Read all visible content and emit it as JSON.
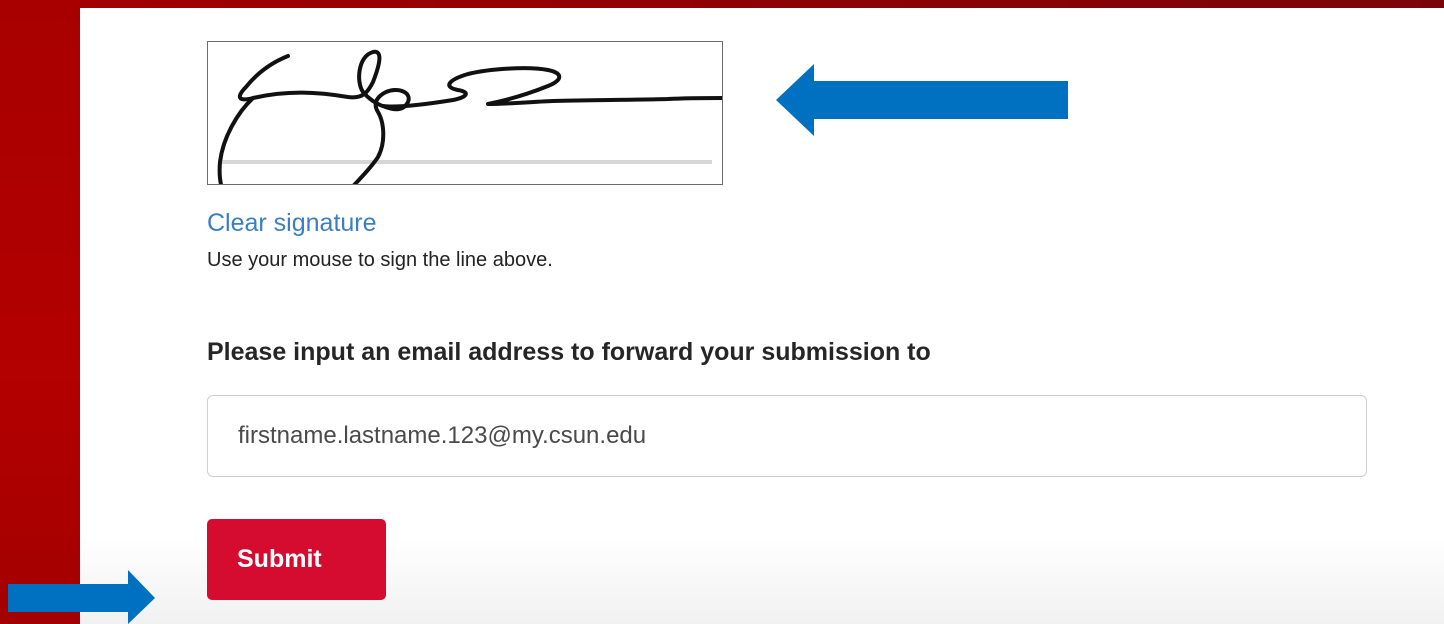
{
  "signature": {
    "clear_label": "Clear signature",
    "help_text": "Use your mouse to sign the line above."
  },
  "email": {
    "label": "Please input an email address to forward your submission to",
    "value": "firstname.lastname.123@my.csun.edu"
  },
  "submit": {
    "label": "Submit"
  },
  "colors": {
    "brand_red": "#d50c2f",
    "background_red": "#a80000",
    "link_blue": "#3a7fc3",
    "annotation_arrow_blue": "#0071c1"
  }
}
